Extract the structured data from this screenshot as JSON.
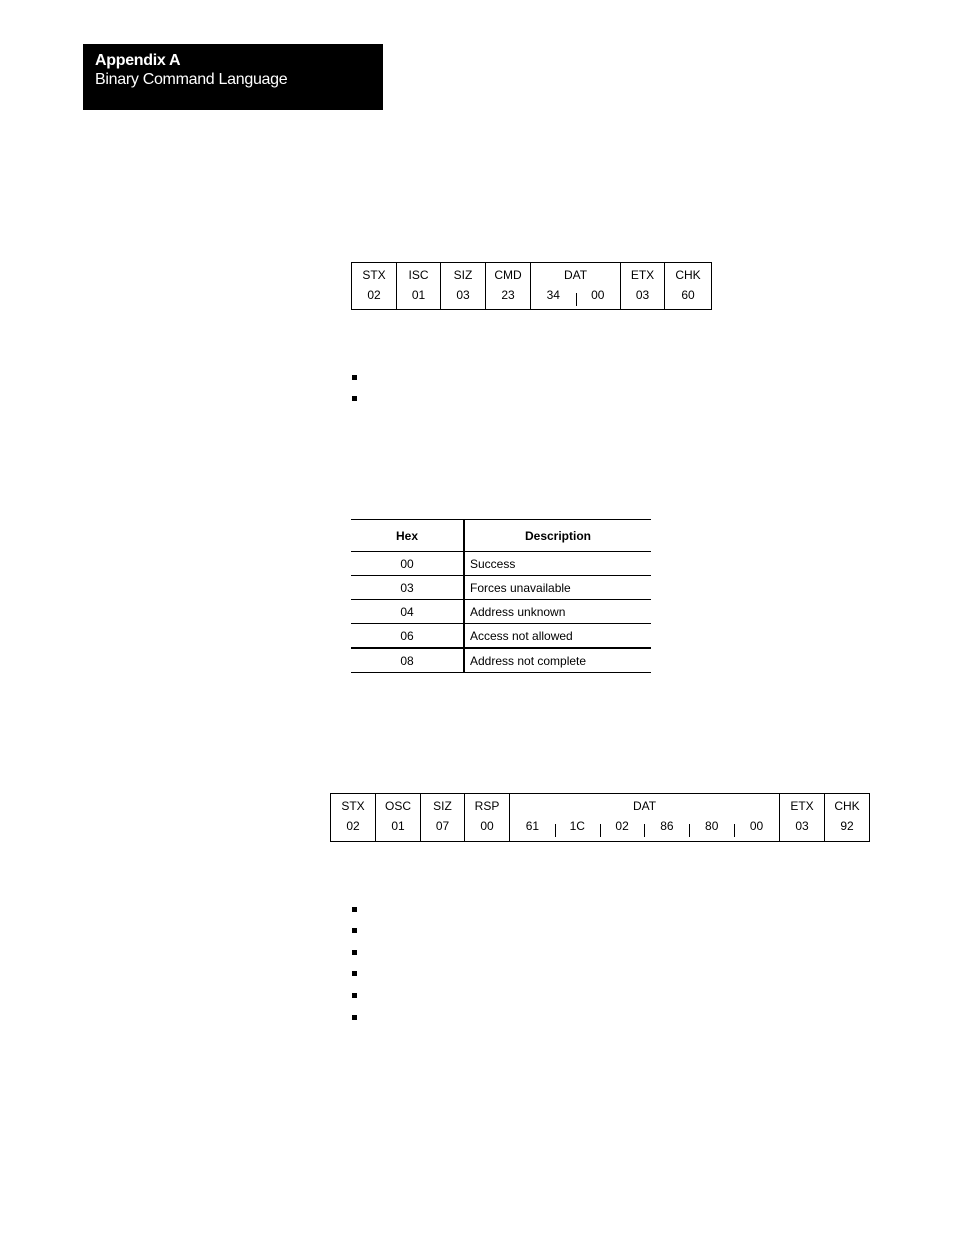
{
  "header": {
    "appendix": "Appendix A",
    "title": "Binary Command Language"
  },
  "command_frame": {
    "fields": [
      {
        "label": "STX",
        "values": [
          "02"
        ]
      },
      {
        "label": "ISC",
        "values": [
          "01"
        ]
      },
      {
        "label": "SIZ",
        "values": [
          "03"
        ]
      },
      {
        "label": "CMD",
        "values": [
          "23"
        ]
      },
      {
        "label": "DAT",
        "values": [
          "34",
          "00"
        ]
      },
      {
        "label": "ETX",
        "values": [
          "03"
        ]
      },
      {
        "label": "CHK",
        "values": [
          "60"
        ]
      }
    ]
  },
  "command_bullets": [
    "",
    ""
  ],
  "status_table": {
    "headers": [
      "Hex",
      "Description"
    ],
    "rows": [
      {
        "hex": "00",
        "description": "Success"
      },
      {
        "hex": "03",
        "description": "Forces unavailable"
      },
      {
        "hex": "04",
        "description": "Address unknown"
      },
      {
        "hex": "06",
        "description": "Access not allowed"
      },
      {
        "hex": "08",
        "description": "Address not complete"
      }
    ]
  },
  "response_frame": {
    "fields": [
      {
        "label": "STX",
        "values": [
          "02"
        ]
      },
      {
        "label": "OSC",
        "values": [
          "01"
        ]
      },
      {
        "label": "SIZ",
        "values": [
          "07"
        ]
      },
      {
        "label": "RSP",
        "values": [
          "00"
        ]
      },
      {
        "label": "DAT",
        "values": [
          "61",
          "1C",
          "02",
          "86",
          "80",
          "00"
        ]
      },
      {
        "label": "ETX",
        "values": [
          "03"
        ]
      },
      {
        "label": "CHK",
        "values": [
          "92"
        ]
      }
    ]
  },
  "response_bullets": [
    "",
    "",
    "",
    "",
    "",
    ""
  ]
}
